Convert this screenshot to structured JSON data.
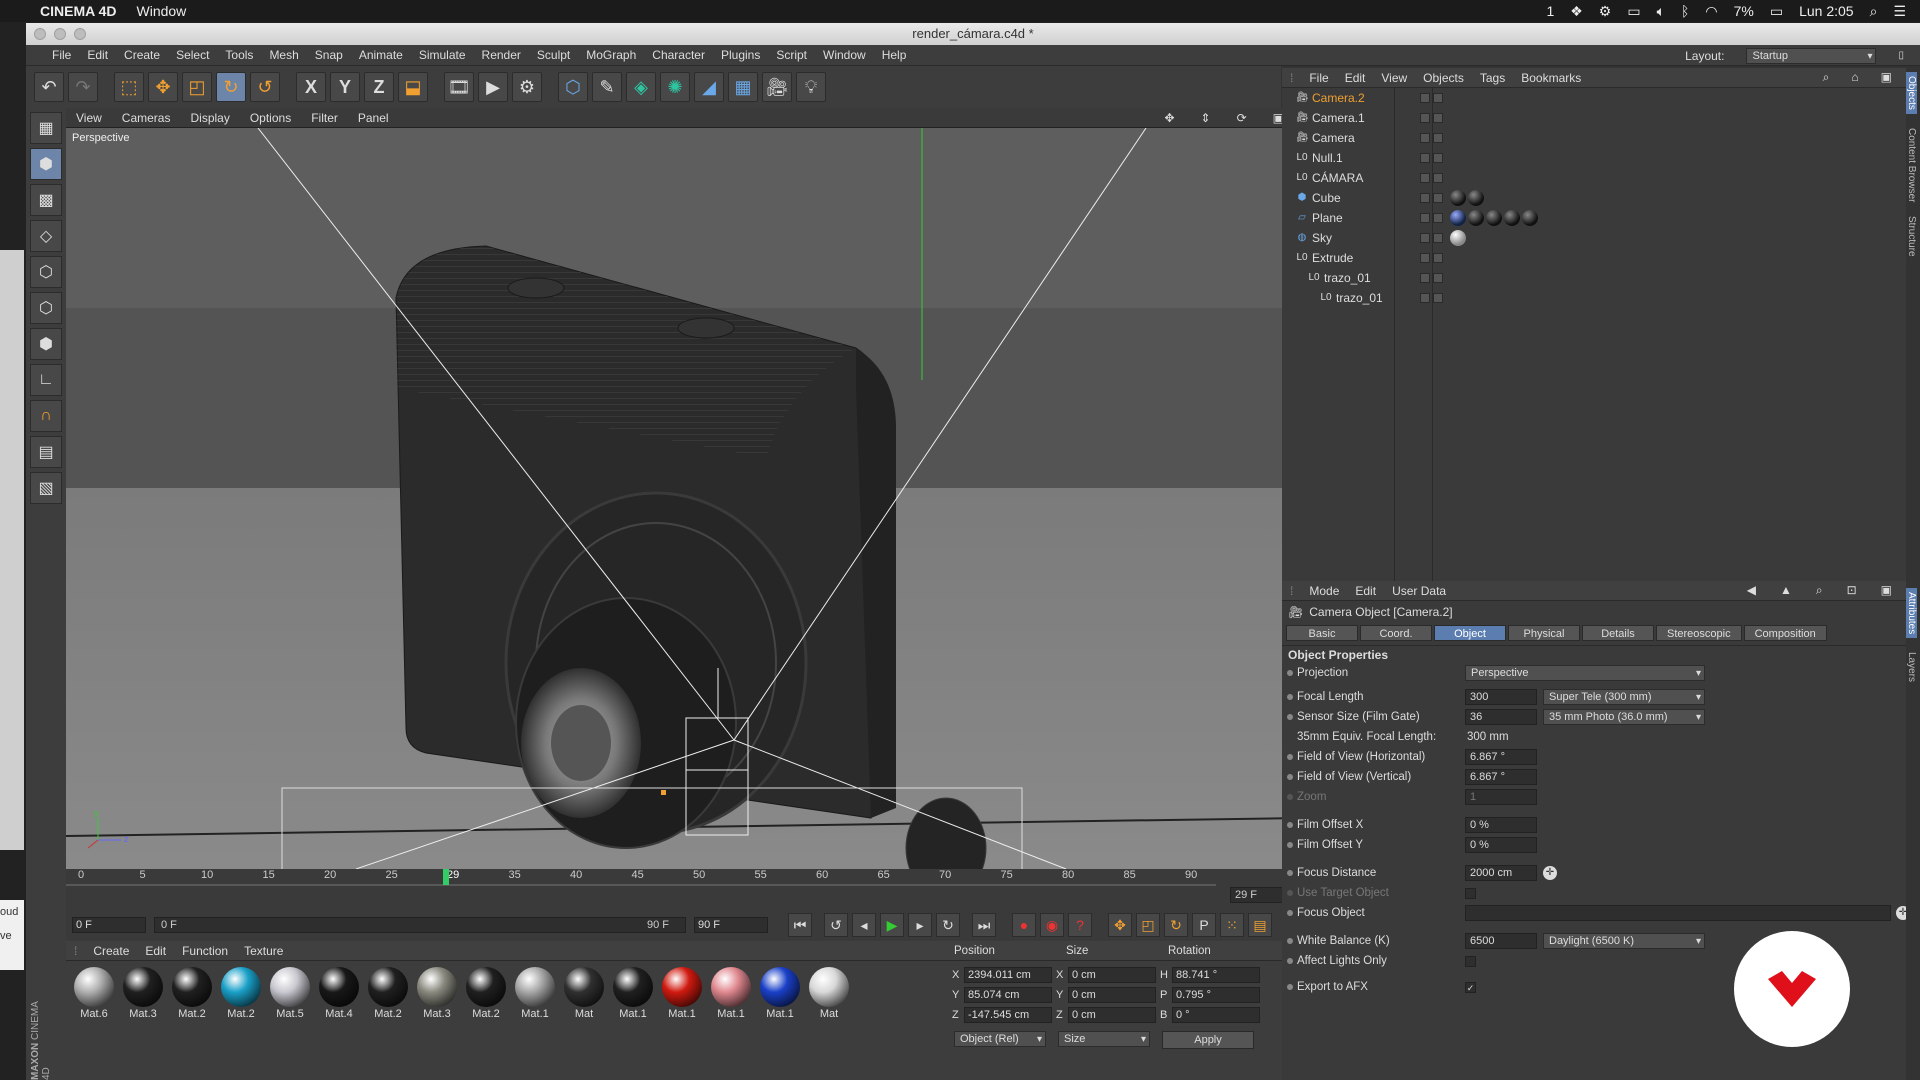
{
  "mac_menubar": {
    "app": "CINEMA 4D",
    "items": [
      "Window"
    ],
    "battery": "7%",
    "clock": "Lun 2:05",
    "notif": "1"
  },
  "window": {
    "title": "render_cámara.c4d *"
  },
  "main_menu": [
    "File",
    "Edit",
    "Create",
    "Select",
    "Tools",
    "Mesh",
    "Snap",
    "Animate",
    "Simulate",
    "Render",
    "Sculpt",
    "MoGraph",
    "Character",
    "Plugins",
    "Script",
    "Window",
    "Help"
  ],
  "layout": {
    "label": "Layout:",
    "value": "Startup"
  },
  "toolbar_axes": [
    "X",
    "Y",
    "Z"
  ],
  "viewport": {
    "menu": [
      "View",
      "Cameras",
      "Display",
      "Options",
      "Filter",
      "Panel"
    ],
    "label": "Perspective"
  },
  "timeline": {
    "ticks": [
      "0",
      "5",
      "10",
      "15",
      "20",
      "25",
      "29",
      "35",
      "40",
      "45",
      "50",
      "55",
      "60",
      "65",
      "70",
      "75",
      "80",
      "85",
      "90"
    ],
    "current_frame": "29 F",
    "start": "0 F",
    "slider_start": "0 F",
    "slider_end": "90 F",
    "end": "90 F"
  },
  "object_manager": {
    "menu": [
      "File",
      "Edit",
      "View",
      "Objects",
      "Tags",
      "Bookmarks"
    ],
    "objects": [
      {
        "name": "Camera.2",
        "icon": "camera-icon",
        "selected": true,
        "indent": 0
      },
      {
        "name": "Camera.1",
        "icon": "camera-icon",
        "selected": false,
        "indent": 0
      },
      {
        "name": "Camera",
        "icon": "camera-icon",
        "selected": false,
        "indent": 0
      },
      {
        "name": "Null.1",
        "icon": "null-icon",
        "selected": false,
        "indent": 0
      },
      {
        "name": "CÁMARA",
        "icon": "null-icon",
        "selected": false,
        "indent": 0
      },
      {
        "name": "Cube",
        "icon": "cube-icon",
        "selected": false,
        "indent": 0
      },
      {
        "name": "Plane",
        "icon": "plane-icon",
        "selected": false,
        "indent": 0
      },
      {
        "name": "Sky",
        "icon": "sky-icon",
        "selected": false,
        "indent": 0
      },
      {
        "name": "Extrude",
        "icon": "extrude-icon",
        "selected": false,
        "indent": 0
      },
      {
        "name": "trazo_01",
        "icon": "null-icon",
        "selected": false,
        "indent": 1
      },
      {
        "name": "trazo_01",
        "icon": "null-icon",
        "selected": false,
        "indent": 2
      }
    ]
  },
  "attributes": {
    "menu": [
      "Mode",
      "Edit",
      "User Data"
    ],
    "title": "Camera Object [Camera.2]",
    "tabs": [
      "Basic",
      "Coord.",
      "Object",
      "Physical",
      "Details",
      "Stereoscopic",
      "Composition"
    ],
    "active_tab": "Object",
    "section": "Object Properties",
    "props": {
      "projection": {
        "label": "Projection",
        "value": "Perspective"
      },
      "focal_length": {
        "label": "Focal Length",
        "value": "300",
        "preset": "Super Tele (300 mm)"
      },
      "sensor_size": {
        "label": "Sensor Size (Film Gate)",
        "value": "36",
        "preset": "35 mm Photo (36.0 mm)"
      },
      "equiv": {
        "label": "35mm Equiv. Focal Length:",
        "value": "300 mm"
      },
      "fov_h": {
        "label": "Field of View (Horizontal)",
        "value": "6.867 °"
      },
      "fov_v": {
        "label": "Field of View (Vertical)",
        "value": "6.867 °"
      },
      "zoom": {
        "label": "Zoom",
        "value": "1"
      },
      "offset_x": {
        "label": "Film Offset X",
        "value": "0 %"
      },
      "offset_y": {
        "label": "Film Offset Y",
        "value": "0 %"
      },
      "focus_distance": {
        "label": "Focus Distance",
        "value": "2000 cm"
      },
      "use_target": {
        "label": "Use Target Object"
      },
      "focus_object": {
        "label": "Focus Object"
      },
      "white_balance": {
        "label": "White Balance (K)",
        "value": "6500",
        "preset": "Daylight (6500 K)"
      },
      "affect_lights": {
        "label": "Affect Lights Only"
      },
      "export_afx": {
        "label": "Export to AFX",
        "check": "✓"
      }
    }
  },
  "materials": {
    "menu": [
      "Create",
      "Edit",
      "Function",
      "Texture"
    ],
    "items": [
      {
        "name": "Mat.6",
        "color": "#b0b0b0"
      },
      {
        "name": "Mat.3",
        "color": "#202020"
      },
      {
        "name": "Mat.2",
        "color": "#202020"
      },
      {
        "name": "Mat.2",
        "color": "#1aa0c8"
      },
      {
        "name": "Mat.5",
        "color": "#c8c8d0"
      },
      {
        "name": "Mat.4",
        "color": "#181818"
      },
      {
        "name": "Mat.2",
        "color": "#202020"
      },
      {
        "name": "Mat.3",
        "color": "#8a8a80"
      },
      {
        "name": "Mat.2",
        "color": "#202020"
      },
      {
        "name": "Mat.1",
        "color": "#a8a8a8"
      },
      {
        "name": "Mat",
        "color": "#303030"
      },
      {
        "name": "Mat.1",
        "color": "#202020"
      },
      {
        "name": "Mat.1",
        "color": "#d01a10"
      },
      {
        "name": "Mat.1",
        "color": "#e08890"
      },
      {
        "name": "Mat.1",
        "color": "#1a40c8"
      },
      {
        "name": "Mat",
        "color": "#d8d8d8"
      }
    ]
  },
  "coords": {
    "headers": [
      "Position",
      "Size",
      "Rotation"
    ],
    "rows": [
      {
        "axis": "X",
        "pos": "2394.011 cm",
        "saxis": "X",
        "size": "0 cm",
        "raxis": "H",
        "rot": "88.741 °"
      },
      {
        "axis": "Y",
        "pos": "85.074 cm",
        "saxis": "Y",
        "size": "0 cm",
        "raxis": "P",
        "rot": "0.795 °"
      },
      {
        "axis": "Z",
        "pos": "-147.545 cm",
        "saxis": "Z",
        "size": "0 cm",
        "raxis": "B",
        "rot": "0 °"
      }
    ],
    "mode": "Object (Rel)",
    "size_mode": "Size",
    "apply": "Apply"
  },
  "branding": {
    "maxon": "MAXON",
    "c4d": "CINEMA 4D"
  },
  "side_tabs": [
    "Objects",
    "Content Browser",
    "Structure",
    "Attributes",
    "Layers"
  ]
}
